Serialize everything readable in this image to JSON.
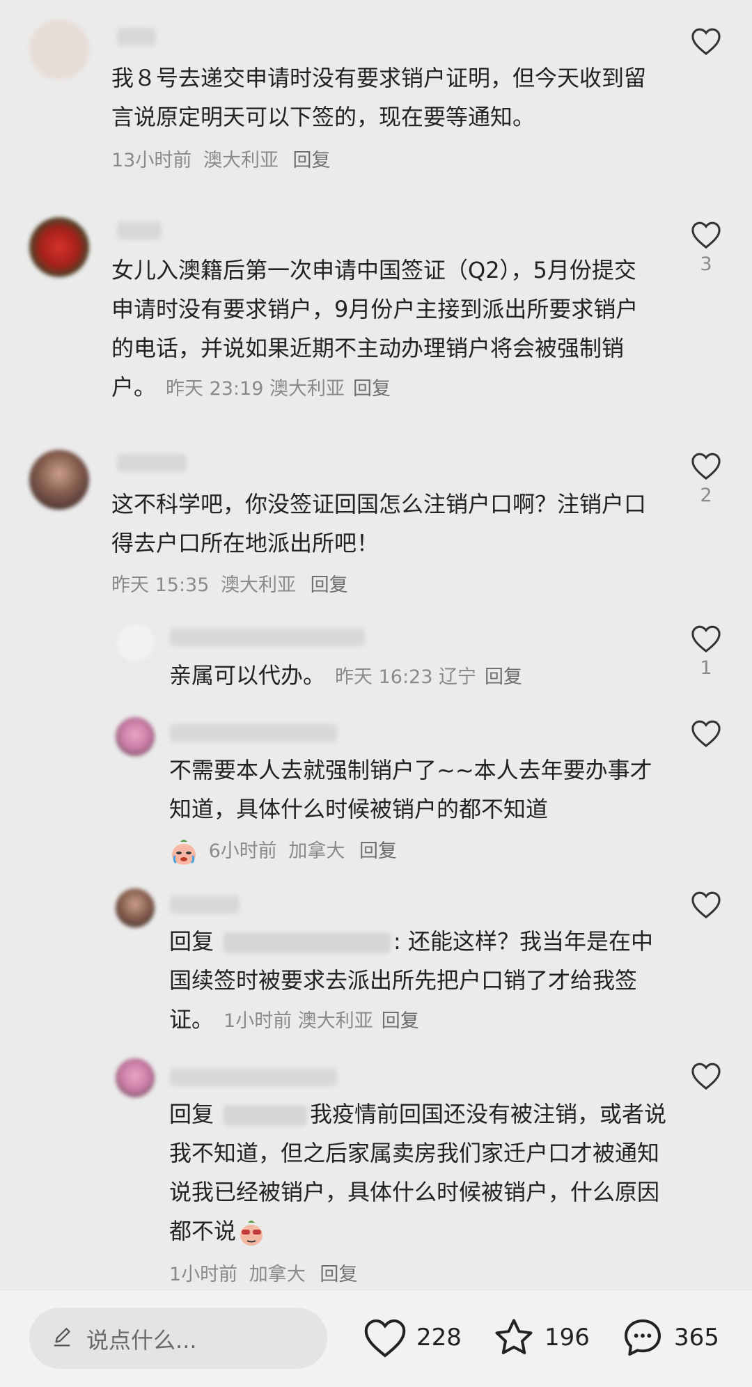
{
  "comments": [
    {
      "text": "我８号去递交申请时没有要求销户证明，但今天收到留言说原定明天可以下签的，现在要等通知。",
      "time": "13小时前",
      "location": "澳大利亚",
      "reply": "回复",
      "likes": ""
    },
    {
      "text": "女儿入澳籍后第一次申请中国签证（Q2），5月份提交申请时没有要求销户，9月份户主接到派出所要求销户的电话，并说如果近期不主动办理销户将会被强制销户。",
      "time": "昨天 23:19",
      "location": "澳大利亚",
      "reply": "回复",
      "likes": "3"
    },
    {
      "text": "这不科学吧，你没签证回国怎么注销户口啊？注销户口得去户口所在地派出所吧！",
      "time": "昨天 15:35",
      "location": "澳大利亚",
      "reply": "回复",
      "likes": "2"
    }
  ],
  "replies": [
    {
      "text": "亲属可以代办。",
      "time": "昨天 16:23",
      "location": "辽宁",
      "reply": "回复",
      "likes": "1"
    },
    {
      "text": "不需要本人去就强制销户了~~本人去年要办事才知道，具体什么时候被销户的都不知道",
      "time": "6小时前",
      "location": "加拿大",
      "reply": "回复",
      "likes": ""
    },
    {
      "prefix": "回复",
      "text": ": 还能这样？我当年是在中国续签时被要求去派出所先把户口销了才给我签证。",
      "time": "1小时前",
      "location": "澳大利亚",
      "reply": "回复",
      "likes": ""
    },
    {
      "prefix": "回复",
      "text": "我疫情前回国还没有被注销，或者说我不知道，但之后家属卖房我们家迁户口才被通知说我已经被销户，具体什么时候被销户，什么原因都不说",
      "time": "1小时前",
      "location": "加拿大",
      "reply": "回复",
      "likes": ""
    }
  ],
  "bottom_bar": {
    "placeholder": "说点什么...",
    "likes": "228",
    "favorites": "196",
    "comments": "365"
  },
  "icons": [
    "heart-icon",
    "star-icon",
    "chat-bubble-icon",
    "pencil-icon"
  ]
}
